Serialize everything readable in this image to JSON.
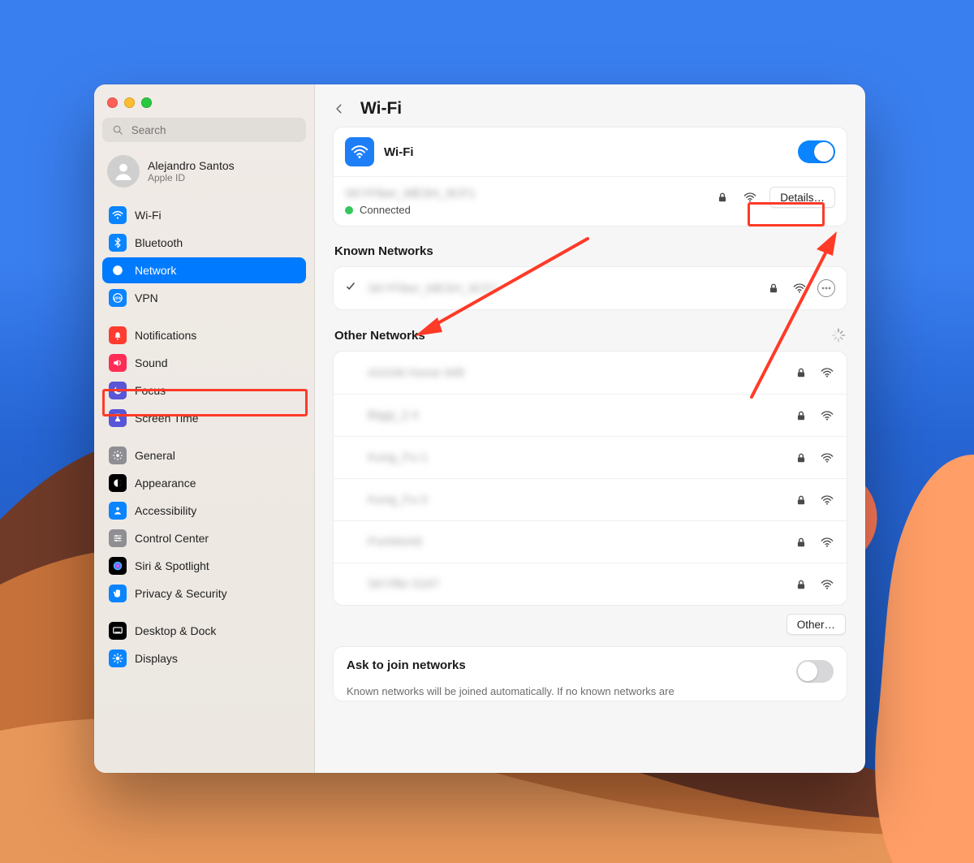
{
  "window": {
    "title": "Wi-Fi"
  },
  "search_placeholder": "Search",
  "account": {
    "name": "Alejandro Santos",
    "sub": "Apple ID"
  },
  "sidebar": {
    "groups": [
      {
        "items": [
          {
            "id": "wifi",
            "label": "Wi-Fi",
            "icon": "wifi",
            "color": "bg-blue"
          },
          {
            "id": "bluetooth",
            "label": "Bluetooth",
            "icon": "bluetooth",
            "color": "bg-blue"
          },
          {
            "id": "network",
            "label": "Network",
            "icon": "globe",
            "color": "bg-blue",
            "selected": true
          },
          {
            "id": "vpn",
            "label": "VPN",
            "icon": "vpn",
            "color": "bg-blue"
          }
        ]
      },
      {
        "items": [
          {
            "id": "notifications",
            "label": "Notifications",
            "icon": "bell",
            "color": "bg-red"
          },
          {
            "id": "sound",
            "label": "Sound",
            "icon": "speaker",
            "color": "bg-pink"
          },
          {
            "id": "focus",
            "label": "Focus",
            "icon": "moon",
            "color": "bg-indigo"
          },
          {
            "id": "screentime",
            "label": "Screen Time",
            "icon": "hourglass",
            "color": "bg-indigo"
          }
        ]
      },
      {
        "items": [
          {
            "id": "general",
            "label": "General",
            "icon": "gear",
            "color": "bg-gray"
          },
          {
            "id": "appearance",
            "label": "Appearance",
            "icon": "appearance",
            "color": "bg-black"
          },
          {
            "id": "accessibility",
            "label": "Accessibility",
            "icon": "person",
            "color": "bg-blue"
          },
          {
            "id": "controlcenter",
            "label": "Control Center",
            "icon": "sliders",
            "color": "bg-gray"
          },
          {
            "id": "siri",
            "label": "Siri & Spotlight",
            "icon": "siri",
            "color": "bg-black"
          },
          {
            "id": "privacy",
            "label": "Privacy & Security",
            "icon": "hand",
            "color": "bg-blue"
          }
        ]
      },
      {
        "items": [
          {
            "id": "desktopdock",
            "label": "Desktop & Dock",
            "icon": "dock",
            "color": "bg-black"
          },
          {
            "id": "displays",
            "label": "Displays",
            "icon": "sun",
            "color": "bg-blue"
          }
        ]
      }
    ]
  },
  "wifi_card": {
    "label": "Wi-Fi",
    "toggle_on": true,
    "current_ssid": "SKYFiber_MESH_9CF1",
    "status": "Connected",
    "details_label": "Details…"
  },
  "known": {
    "title": "Known Networks",
    "items": [
      {
        "ssid": "SKYFiber_MESH_9CF1",
        "locked": true,
        "connected": true
      }
    ]
  },
  "other": {
    "title": "Other Networks",
    "items": [
      {
        "ssid": "AGGM Home Wifi",
        "locked": true
      },
      {
        "ssid": "Biggi_2.4",
        "locked": true
      },
      {
        "ssid": "Kung_Fu-1",
        "locked": true
      },
      {
        "ssid": "Kung_Fu-2",
        "locked": true
      },
      {
        "ssid": "PortWorld",
        "locked": true
      },
      {
        "ssid": "SKYfibr 0167",
        "locked": true
      }
    ],
    "other_button": "Other…"
  },
  "ask": {
    "title": "Ask to join networks",
    "sub": "Known networks will be joined automatically. If no known networks are",
    "on": false
  },
  "annotations": {
    "highlight_color": "#ff3a27",
    "arrows_point_to": [
      "sidebar-item-network",
      "details-button"
    ]
  }
}
